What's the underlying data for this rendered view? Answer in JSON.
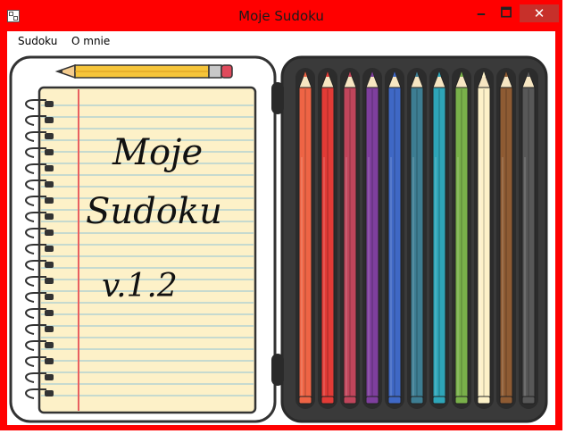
{
  "window": {
    "title": "Moje Sudoku",
    "controls": {
      "minimize": "🗕",
      "maximize": "🗖",
      "close": "✕"
    }
  },
  "menu": {
    "items": [
      "Sudoku",
      "O mnie"
    ]
  },
  "notebook": {
    "line1": "Moje",
    "line2": "Sudoku",
    "version": "v.1.2"
  },
  "colors": {
    "frame": "#ff0000",
    "paper": "#fdf1c8",
    "case": "#3a3a3a",
    "pencils": [
      "#ee6445",
      "#e23b36",
      "#c0455b",
      "#7e3f9d",
      "#3f68c5",
      "#3d7d92",
      "#2ea5b8",
      "#79b04a",
      "#fdf1c8",
      "#8e5b33",
      "#585858"
    ]
  }
}
